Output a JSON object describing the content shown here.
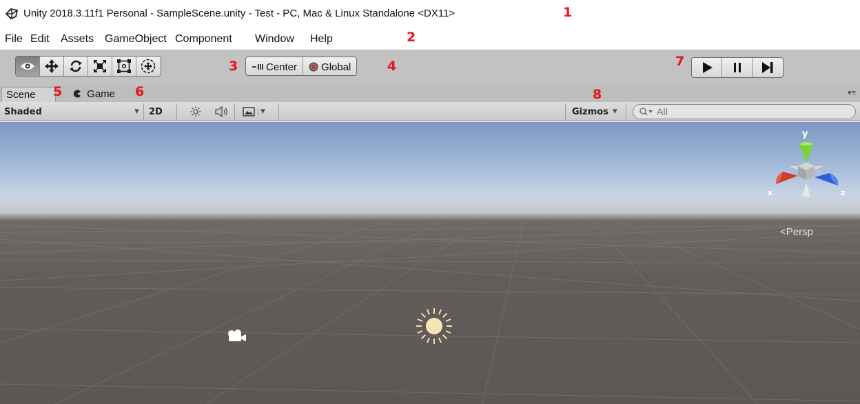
{
  "window": {
    "title": "Unity 2018.3.11f1 Personal - SampleScene.unity - Test - PC, Mac & Linux Standalone <DX11>",
    "icon": "unity-logo-icon"
  },
  "annotations": [
    "1",
    "2",
    "3",
    "4",
    "5",
    "6",
    "7",
    "8"
  ],
  "menu": [
    "File",
    "Edit",
    "Assets",
    "GameObject",
    "Component",
    "Window",
    "Help"
  ],
  "toolbar": {
    "transform_tools": [
      {
        "name": "view-tool",
        "icon": "eye-icon",
        "active": true
      },
      {
        "name": "move-tool",
        "icon": "move-arrows-icon"
      },
      {
        "name": "rotate-tool",
        "icon": "rotate-icon"
      },
      {
        "name": "scale-tool",
        "icon": "scale-icon"
      },
      {
        "name": "rect-tool",
        "icon": "rect-transform-icon"
      },
      {
        "name": "transform-tool",
        "icon": "combined-transform-icon"
      }
    ],
    "pivot": {
      "center_label": "Center",
      "global_label": "Global"
    },
    "playback": [
      "play-icon",
      "pause-icon",
      "step-icon"
    ]
  },
  "tabs": {
    "scene": "Scene",
    "game": "Game"
  },
  "scene_toolbar": {
    "draw_mode": "Shaded",
    "mode_2d": "2D",
    "gizmos": "Gizmos",
    "search_placeholder": "All"
  },
  "scene_view": {
    "gizmo_axes": {
      "x": "x",
      "y": "y",
      "z": "z"
    },
    "projection": "Persp"
  },
  "colors": {
    "annotation": "#e8141b",
    "axis_x": "#d23a2a",
    "axis_y": "#7ad23a",
    "axis_z": "#2f5fd6"
  }
}
